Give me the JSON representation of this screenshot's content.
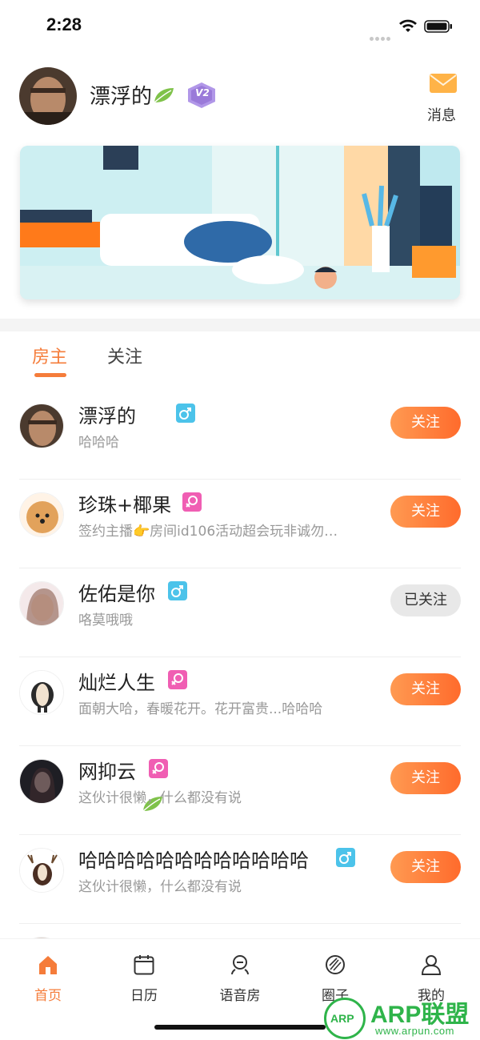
{
  "status_bar": {
    "time": "2:28"
  },
  "header": {
    "user_name": "漂浮的",
    "level_badge": "V2",
    "message_label": "消息"
  },
  "tabs": [
    {
      "label": "房主",
      "active": true
    },
    {
      "label": "关注",
      "active": false
    }
  ],
  "list": [
    {
      "name": "漂浮的",
      "desc": "哈哈哈",
      "gender": "male",
      "leaf": true,
      "button": "关注",
      "followed": false
    },
    {
      "name": "珍珠+椰果",
      "desc": "签约主播👉房间id106活动超会玩非诚勿…",
      "gender": "female",
      "leaf": false,
      "button": "关注",
      "followed": false
    },
    {
      "name": "佐佑是你",
      "desc": "咯莫哦哦",
      "gender": "male",
      "leaf": false,
      "button": "已关注",
      "followed": true
    },
    {
      "name": "灿烂人生",
      "desc": "面朝大哈，春暖花开。花开富贵...哈哈哈",
      "gender": "female",
      "leaf": false,
      "button": "关注",
      "followed": false
    },
    {
      "name": "网抑云",
      "desc": "这伙计很懒，什么都没有说",
      "gender": "female",
      "leaf": false,
      "button": "关注",
      "followed": false
    },
    {
      "name": "哈哈哈哈哈哈哈哈哈哈哈哈",
      "desc": "这伙计很懒，什么都没有说",
      "gender": "male",
      "leaf": false,
      "button": "关注",
      "followed": false
    }
  ],
  "tabbar": [
    {
      "label": "首页",
      "icon": "home-icon",
      "active": true
    },
    {
      "label": "日历",
      "icon": "calendar-icon",
      "active": false
    },
    {
      "label": "语音房",
      "icon": "voice-room-icon",
      "active": false
    },
    {
      "label": "圈子",
      "icon": "circle-icon",
      "active": false
    },
    {
      "label": "我的",
      "icon": "profile-icon",
      "active": false
    }
  ],
  "watermark": {
    "title": "ARP联盟",
    "url": "www.arpun.com",
    "logo_text": "ARP"
  },
  "colors": {
    "accent": "#f57c3a",
    "male": "#4cc3ea",
    "female": "#f05eb3",
    "followed_bg": "#e8e8e8"
  }
}
